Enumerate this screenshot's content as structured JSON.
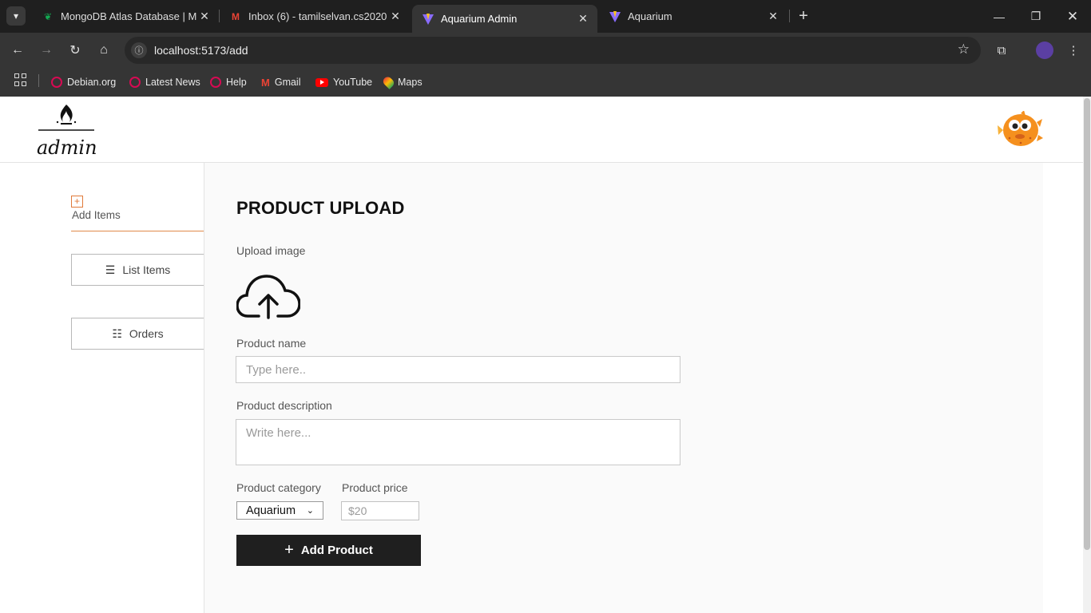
{
  "browser": {
    "tabs": [
      {
        "title": "MongoDB Atlas Database | Mul",
        "favicon": "mongodb-leaf-icon"
      },
      {
        "title": "Inbox (6) - tamilselvan.cs2020@",
        "favicon": "gmail-icon"
      },
      {
        "title": "Aquarium Admin",
        "favicon": "vite-icon",
        "active": true
      },
      {
        "title": "Aquarium",
        "favicon": "vite-icon"
      }
    ],
    "url": "localhost:5173/add",
    "bookmarks": [
      "Debian.org",
      "Latest News",
      "Help",
      "Gmail",
      "YouTube",
      "Maps"
    ]
  },
  "app": {
    "logo_text": "admin",
    "sidebar": {
      "active_item": "Add Items",
      "items": [
        "List Items",
        "Orders"
      ]
    },
    "form": {
      "heading": "PRODUCT UPLOAD",
      "upload_label": "Upload image",
      "name_label": "Product name",
      "name_placeholder": "Type here..",
      "description_label": "Product description",
      "description_placeholder": "Write here...",
      "category_label": "Product category",
      "category_value": "Aquarium",
      "price_label": "Product price",
      "price_placeholder": "$20",
      "submit_label": "Add Product"
    }
  },
  "colors": {
    "accent": "#e07a3a",
    "button": "#1f1f1f",
    "chrome_dark": "#1f1f1f"
  }
}
